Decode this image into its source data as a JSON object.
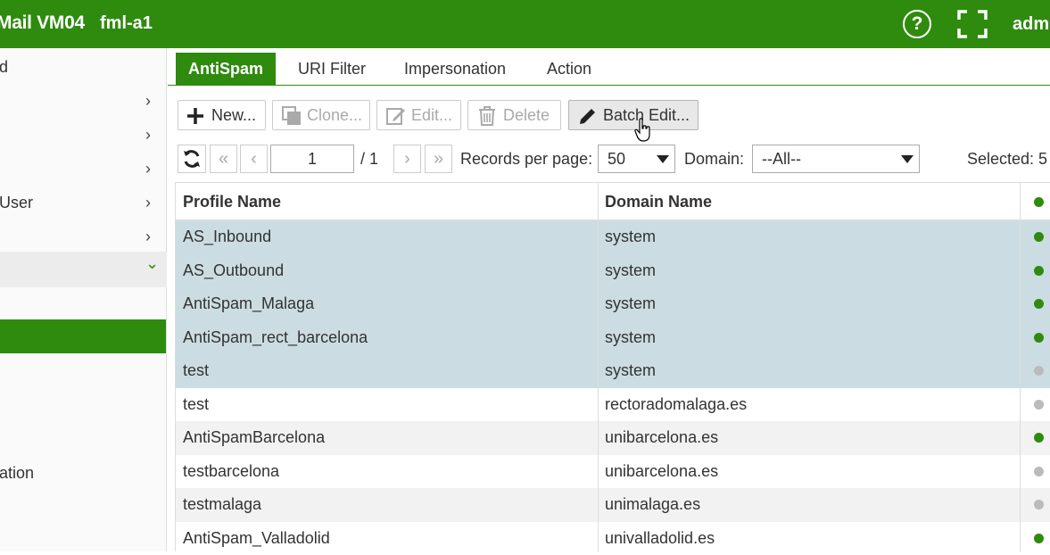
{
  "header": {
    "app_title": "Mail VM04",
    "host_name": "fml-a1",
    "user_name": "admi",
    "help_icon_glyph": "?",
    "bg_color": "#2e8b0e"
  },
  "sidebar": {
    "items": [
      {
        "label": "d",
        "chevron": ""
      },
      {
        "label": "",
        "chevron": "›"
      },
      {
        "label": "",
        "chevron": "›"
      },
      {
        "label": "",
        "chevron": "›"
      },
      {
        "label": "User",
        "chevron": "›"
      },
      {
        "label": "",
        "chevron": "›"
      },
      {
        "label": "",
        "chevron": "⌄"
      },
      {
        "label": "ation",
        "chevron": ""
      }
    ]
  },
  "tabs": [
    "AntiSpam",
    "URI Filter",
    "Impersonation",
    "Action"
  ],
  "toolbar": {
    "new_label": "New...",
    "clone_label": "Clone...",
    "edit_label": "Edit...",
    "delete_label": "Delete",
    "batch_edit_label": "Batch Edit..."
  },
  "pager": {
    "first_glyph": "«",
    "prev_glyph": "‹",
    "next_glyph": "›",
    "last_glyph": "»",
    "refresh_glyph": "⟳",
    "current_page": "1",
    "total_pages": "/ 1",
    "records_label": "Records per page:",
    "records_value": "50",
    "domain_label": "Domain:",
    "domain_value": "--All--",
    "selected_label": "Selected: 5"
  },
  "table": {
    "columns": [
      "Profile Name",
      "Domain Name"
    ],
    "rows": [
      {
        "profile": "AS_Inbound",
        "domain": "system",
        "enabled": true,
        "selected": true
      },
      {
        "profile": "AS_Outbound",
        "domain": "system",
        "enabled": true,
        "selected": true
      },
      {
        "profile": "AntiSpam_Malaga",
        "domain": "system",
        "enabled": true,
        "selected": true
      },
      {
        "profile": "AntiSpam_rect_barcelona",
        "domain": "system",
        "enabled": true,
        "selected": true
      },
      {
        "profile": "test",
        "domain": "system",
        "enabled": false,
        "selected": true
      },
      {
        "profile": "test",
        "domain": "rectoradomalaga.es",
        "enabled": false,
        "selected": false
      },
      {
        "profile": "AntiSpamBarcelona",
        "domain": "unibarcelona.es",
        "enabled": true,
        "selected": false
      },
      {
        "profile": "testbarcelona",
        "domain": "unibarcelona.es",
        "enabled": false,
        "selected": false
      },
      {
        "profile": "testmalaga",
        "domain": "unimalaga.es",
        "enabled": false,
        "selected": false
      },
      {
        "profile": "AntiSpam_Valladolid",
        "domain": "univalladolid.es",
        "enabled": true,
        "selected": false
      }
    ]
  },
  "colors": {
    "brand_green": "#2e8b0e",
    "selected_row": "#cbdde3",
    "alt_row": "#f2f2f2",
    "dot_enabled": "#2e8b0e",
    "dot_disabled": "#bbbbbb"
  }
}
